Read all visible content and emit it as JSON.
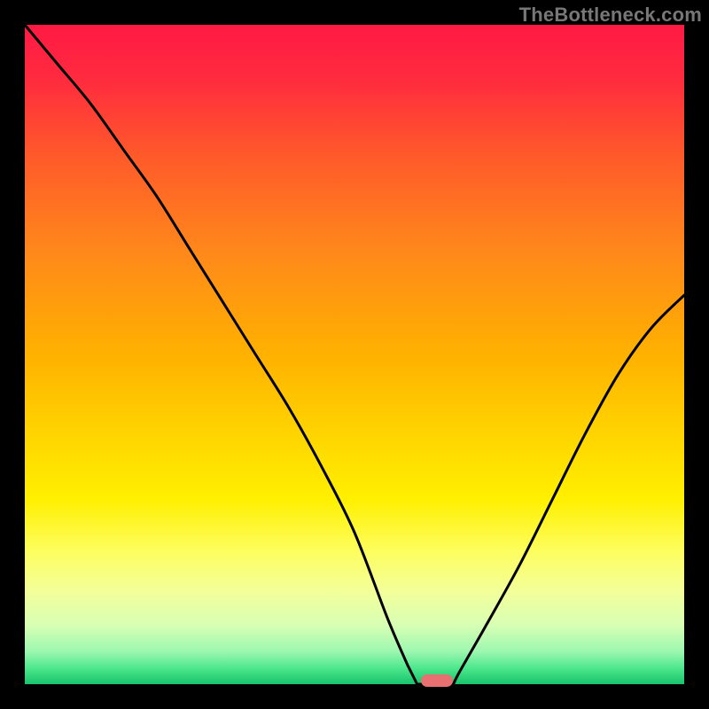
{
  "watermark": "TheBottleneck.com",
  "gradient": {
    "stops": [
      {
        "offset": 0.0,
        "color": "#ff1a44"
      },
      {
        "offset": 0.08,
        "color": "#ff2a3f"
      },
      {
        "offset": 0.2,
        "color": "#ff5a2a"
      },
      {
        "offset": 0.35,
        "color": "#ff8a1a"
      },
      {
        "offset": 0.5,
        "color": "#ffb100"
      },
      {
        "offset": 0.62,
        "color": "#ffd400"
      },
      {
        "offset": 0.72,
        "color": "#fff000"
      },
      {
        "offset": 0.8,
        "color": "#fdfe60"
      },
      {
        "offset": 0.86,
        "color": "#f3ff9a"
      },
      {
        "offset": 0.91,
        "color": "#d8ffb4"
      },
      {
        "offset": 0.95,
        "color": "#9ef7b0"
      },
      {
        "offset": 0.975,
        "color": "#4fe88e"
      },
      {
        "offset": 1.0,
        "color": "#18c36b"
      }
    ]
  },
  "chart_data": {
    "type": "line",
    "title": "",
    "xlabel": "",
    "ylabel": "",
    "xlim": [
      0,
      1
    ],
    "ylim": [
      0,
      1
    ],
    "x": [
      0.0,
      0.05,
      0.1,
      0.15,
      0.2,
      0.25,
      0.3,
      0.35,
      0.4,
      0.45,
      0.5,
      0.55,
      0.58,
      0.6,
      0.62,
      0.64,
      0.66,
      0.7,
      0.75,
      0.8,
      0.85,
      0.9,
      0.95,
      1.0
    ],
    "y": [
      1.0,
      0.94,
      0.88,
      0.81,
      0.74,
      0.66,
      0.58,
      0.5,
      0.42,
      0.33,
      0.23,
      0.1,
      0.03,
      0.0,
      0.0,
      0.0,
      0.02,
      0.09,
      0.18,
      0.28,
      0.38,
      0.47,
      0.54,
      0.59
    ],
    "marker": {
      "x": 0.625,
      "y": 0.0
    },
    "flat_range": [
      0.595,
      0.65
    ]
  }
}
